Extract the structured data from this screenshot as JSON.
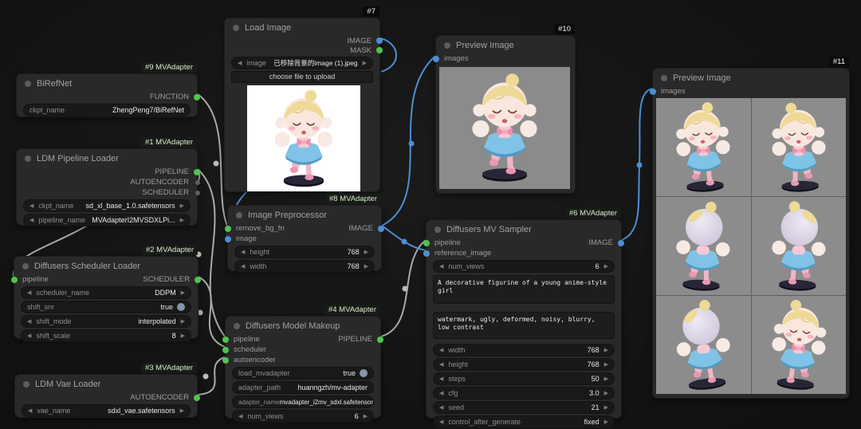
{
  "icons": {
    "arrow_left": "◀",
    "arrow_right": "▶"
  },
  "colors": {
    "accent_blue": "#4d8fd6",
    "accent_green": "#4fc44f",
    "wire_gray": "#b8bdb5"
  },
  "badges": {
    "birefnet": "#9 MVAdapter",
    "pipeline_loader": "#1 MVAdapter",
    "scheduler_loader": "#2 MVAdapter",
    "vae_loader": "#3 MVAdapter",
    "load_image": "#7",
    "image_preprocessor": "#8 MVAdapter",
    "model_makeup": "#4 MVAdapter",
    "preview_top": "#10",
    "mv_sampler": "#6 MVAdapter",
    "preview_right": "#11"
  },
  "nodes": {
    "birefnet": {
      "title": "BiRefNet",
      "out_function": "FUNCTION",
      "ckpt_label": "ckpt_name",
      "ckpt_value": "ZhengPeng7/BiRefNet"
    },
    "pipeline_loader": {
      "title": "LDM Pipeline Loader",
      "out_pipeline": "PIPELINE",
      "out_autoencoder": "AUTOENCODER",
      "out_scheduler": "SCHEDULER",
      "ckpt_label": "ckpt_name",
      "ckpt_value": "sd_xl_base_1.0.safetensors",
      "pipe_label": "pipeline_name",
      "pipe_value": "MVAdapterI2MVSDXLPi..."
    },
    "scheduler_loader": {
      "title": "Diffusers Scheduler Loader",
      "in_pipeline": "pipeline",
      "out_scheduler": "SCHEDULER",
      "scheduler_name_label": "scheduler_name",
      "scheduler_name_value": "DDPM",
      "shift_snr_label": "shift_snr",
      "shift_snr_value": "true",
      "shift_mode_label": "shift_mode",
      "shift_mode_value": "interpolated",
      "shift_scale_label": "shift_scale",
      "shift_scale_value": "8"
    },
    "vae_loader": {
      "title": "LDM Vae Loader",
      "out_autoencoder": "AUTOENCODER",
      "vae_label": "vae_name",
      "vae_value": "sdxl_vae.safetensors"
    },
    "load_image": {
      "title": "Load Image",
      "out_image": "IMAGE",
      "out_mask": "MASK",
      "image_label": "image",
      "image_value": "已移除背景的image (1).jpeg",
      "upload_button": "choose file to upload"
    },
    "image_preprocessor": {
      "title": "Image Preprocessor",
      "in_remove_bg": "remove_bg_fn",
      "in_image": "image",
      "out_image": "IMAGE",
      "height_label": "height",
      "height_value": "768",
      "width_label": "width",
      "width_value": "768"
    },
    "model_makeup": {
      "title": "Diffusers Model Makeup",
      "in_pipeline": "pipeline",
      "in_scheduler": "scheduler",
      "in_autoencoder": "autoencoder",
      "out_pipeline": "PIPELINE",
      "load_mvadapter_label": "load_mvadapter",
      "load_mvadapter_value": "true",
      "adapter_path_label": "adapter_path",
      "adapter_path_value": "huanngzh/mv-adapter",
      "adapter_name_label": "adapter_name",
      "adapter_name_value": "mvadapter_i2mv_sdxl.safetensor",
      "num_views_label": "num_views",
      "num_views_value": "6"
    },
    "preview_top": {
      "title": "Preview Image",
      "in_images": "images"
    },
    "mv_sampler": {
      "title": "Diffusers MV Sampler",
      "in_pipeline": "pipeline",
      "in_reference": "reference_image",
      "out_image": "IMAGE",
      "num_views_label": "num_views",
      "num_views_value": "6",
      "positive_prompt": "A decorative figurine of a young anime-style girl",
      "negative_prompt": "watermark, ugly, deformed, noisy, blurry, low contrast",
      "width_label": "width",
      "width_value": "768",
      "height_label": "height",
      "height_value": "768",
      "steps_label": "steps",
      "steps_value": "50",
      "cfg_label": "cfg",
      "cfg_value": "3.0",
      "seed_label": "seed",
      "seed_value": "21",
      "cag_label": "control_after_generate",
      "cag_value": "fixed"
    },
    "preview_right": {
      "title": "Preview Image",
      "in_images": "images"
    }
  }
}
